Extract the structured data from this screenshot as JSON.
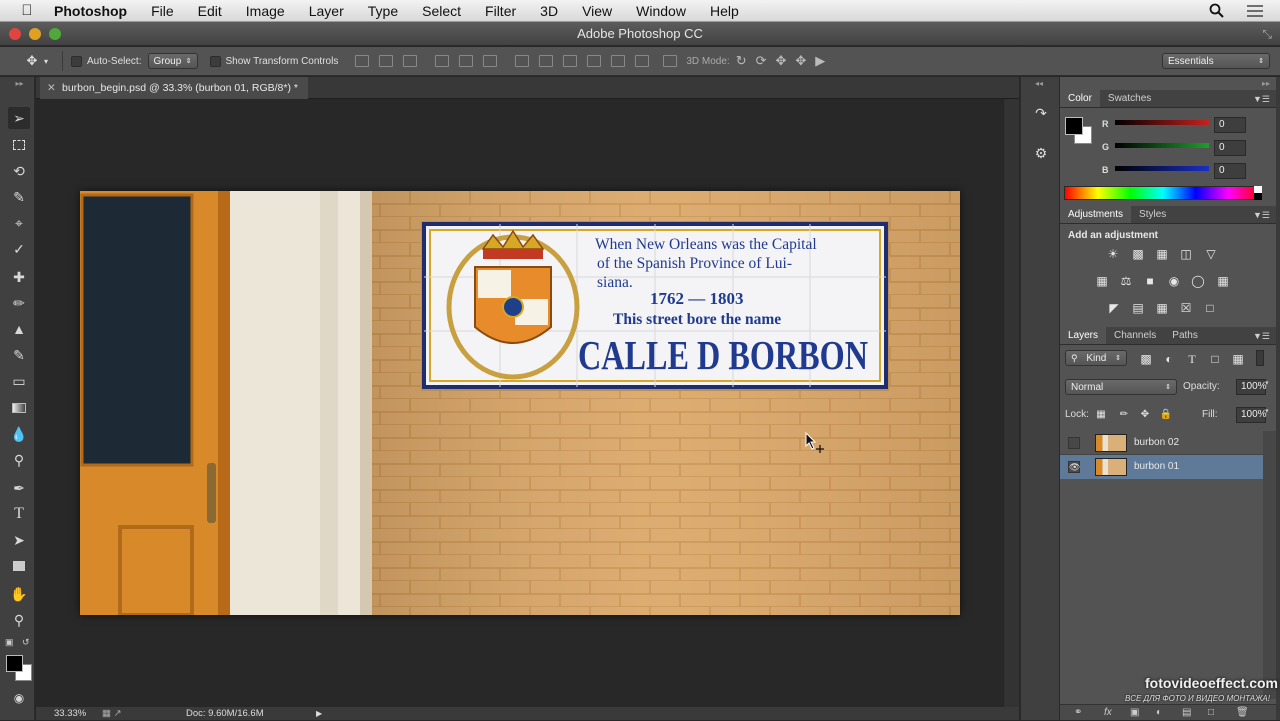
{
  "menubar": {
    "app_name": "Photoshop",
    "items": [
      "File",
      "Edit",
      "Image",
      "Layer",
      "Type",
      "Select",
      "Filter",
      "3D",
      "View",
      "Window",
      "Help"
    ]
  },
  "window": {
    "title": "Adobe Photoshop CC"
  },
  "options": {
    "auto_select_label": "Auto-Select:",
    "auto_select_value": "Group",
    "transform_label": "Show Transform Controls",
    "mode_3d_label": "3D Mode:",
    "workspace": "Essentials"
  },
  "document": {
    "tab_title": "burbon_begin.psd @ 33.3% (burbon 01, RGB/8*) *",
    "sign_line1": "When New Orleans was the Capital",
    "sign_line2": "of the Spanish Province of Lui-",
    "sign_line3": "siana.",
    "sign_years": "1762  —  1803",
    "sign_line4": "This street bore the name",
    "sign_street": "CALLE D BORBON"
  },
  "status": {
    "zoom": "33.33%",
    "doc": "Doc: 9.60M/16.6M"
  },
  "color_panel": {
    "tabs": [
      "Color",
      "Swatches"
    ],
    "r_label": "R",
    "g_label": "G",
    "b_label": "B",
    "r": "0",
    "g": "0",
    "b": "0",
    "colors": {
      "r": "#c8201e",
      "g": "#1e9e2c",
      "b": "#1a2fc8"
    }
  },
  "adjustments_panel": {
    "tabs": [
      "Adjustments",
      "Styles"
    ],
    "heading": "Add an adjustment"
  },
  "layers_panel": {
    "tabs": [
      "Layers",
      "Channels",
      "Paths"
    ],
    "kind": "Kind",
    "blend_mode": "Normal",
    "opacity_label": "Opacity:",
    "opacity": "100%",
    "lock_label": "Lock:",
    "fill_label": "Fill:",
    "fill": "100%",
    "layers": [
      {
        "name": "burbon 02",
        "visible": false
      },
      {
        "name": "burbon 01",
        "visible": true,
        "selected": true
      }
    ]
  },
  "watermark": {
    "line1": "fotovideoeffect.com",
    "line2": "ВСЕ ДЛЯ ФОТО И ВИДЕО МОНТАЖА!"
  }
}
